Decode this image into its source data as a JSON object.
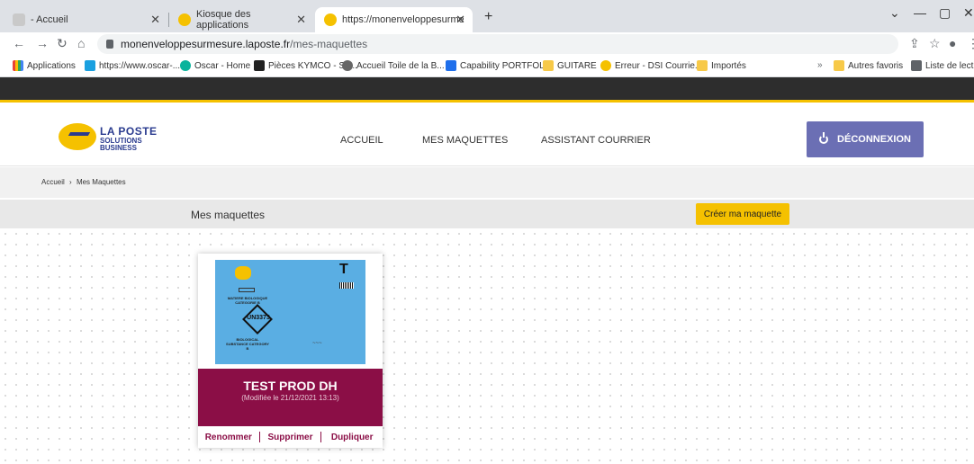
{
  "browser": {
    "tabs": [
      {
        "label": "- Accueil",
        "close": "✕"
      },
      {
        "label": "Kiosque des applications",
        "close": "✕"
      },
      {
        "label": "https://monenveloppesurmesure",
        "close": "✕"
      }
    ],
    "new_tab": "+",
    "url_host": "monenveloppesurmesure.laposte.fr",
    "url_path": "/mes-maquettes",
    "window_controls": [
      "⌄",
      "—",
      "▢",
      "✕"
    ]
  },
  "bookmarks": {
    "items": [
      "Applications",
      "https://www.oscar-...",
      "Oscar - Home",
      "Pièces KYMCO - Su...",
      "Accueil Toile de la B...",
      "Capability PORTFOL...",
      "GUITARE",
      "Erreur - DSI Courrie...",
      "Importés"
    ],
    "overflow": "»",
    "other": "Autres favoris",
    "reading": "Liste de lecture"
  },
  "header": {
    "logo_line1": "LA POSTE",
    "logo_line2": "SOLUTIONS BUSINESS",
    "nav": [
      "ACCUEIL",
      "MES MAQUETTES",
      "ASSISTANT COURRIER"
    ],
    "logout": "DÉCONNEXION"
  },
  "breadcrumb": {
    "home": "Accueil",
    "sep": "›",
    "current": "Mes Maquettes"
  },
  "section": {
    "title": "Mes maquettes",
    "create_button": "Créer ma maquette"
  },
  "card": {
    "title": "TEST PROD DH",
    "modified": "(Modifiée le 21/12/2021 13:13)",
    "envelope": {
      "stamp": "T",
      "un_code": "UN3373",
      "text_top": "MATIERE BIOLOGIQUE CATEGORIE B",
      "text_bottom": "BIOLOGICAL SUBSTANCE CATEGORY B"
    },
    "actions": [
      "Renommer",
      "Supprimer",
      "Dupliquer"
    ]
  },
  "colors": {
    "brand_yellow": "#f5c100",
    "brand_blue": "#2a3b8f",
    "card_band": "#8b0e46",
    "logout_button": "#6b6fb4",
    "envelope_blue": "#5aaee3"
  }
}
